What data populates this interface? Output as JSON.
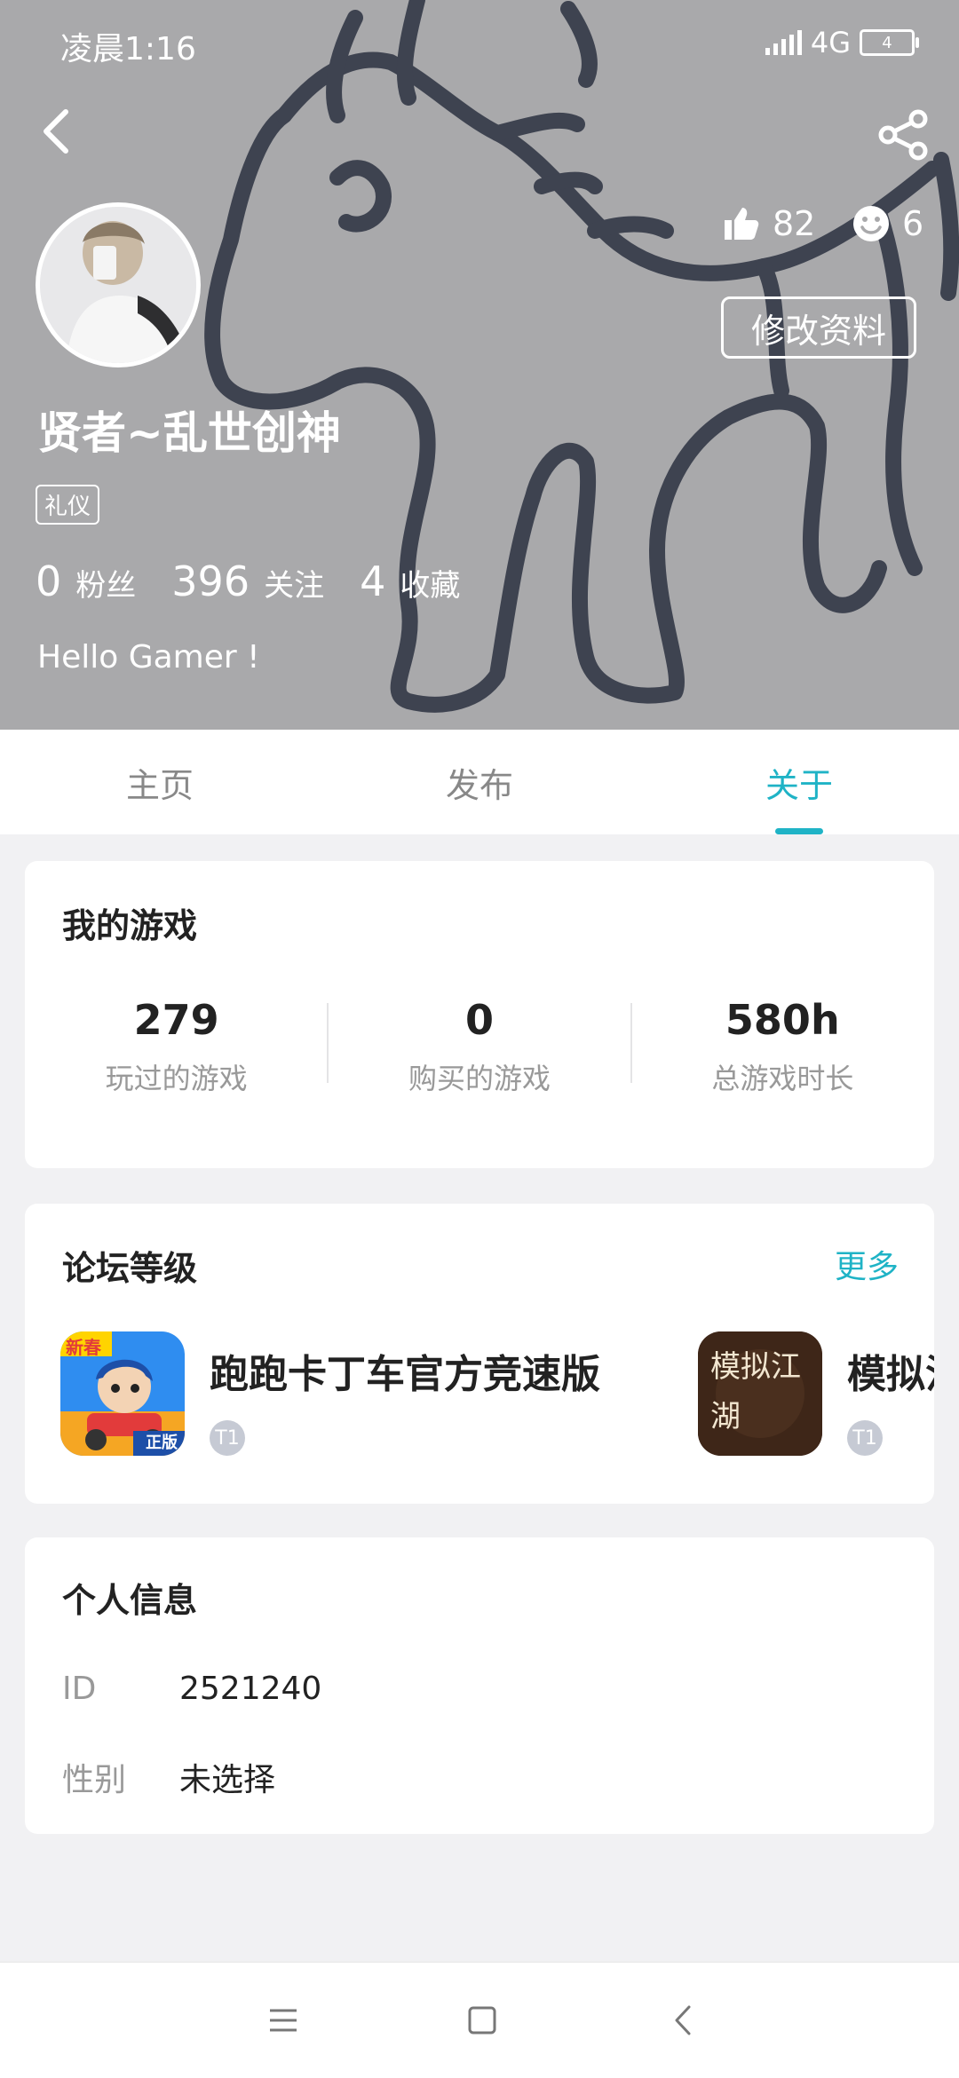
{
  "status": {
    "time": "凌晨1:16",
    "network": "4G",
    "battery": "4"
  },
  "profile": {
    "name": "贤者~乱世创神",
    "tag": "礼仪",
    "fans_count": "0",
    "fans_label": "粉丝",
    "following_count": "396",
    "following_label": "关注",
    "favorites_count": "4",
    "favorites_label": "收藏",
    "bio": "Hello Gamer !",
    "likes": "82",
    "faces": "6",
    "edit_label": "修改资料"
  },
  "tabs": [
    {
      "label": "主页",
      "active": false
    },
    {
      "label": "发布",
      "active": false
    },
    {
      "label": "关于",
      "active": true
    }
  ],
  "my_games": {
    "title": "我的游戏",
    "stats": [
      {
        "value": "279",
        "label": "玩过的游戏"
      },
      {
        "value": "0",
        "label": "购买的游戏"
      },
      {
        "value": "580h",
        "label": "总游戏时长"
      }
    ]
  },
  "forum": {
    "title": "论坛等级",
    "more": "更多",
    "games": [
      {
        "name": "跑跑卡丁车官方竞速版",
        "icon_badge": "新春",
        "icon_corner": "正版",
        "level": "T1"
      },
      {
        "name": "模拟江湖",
        "icon_text": "模拟江湖",
        "level": "T1"
      }
    ]
  },
  "personal": {
    "title": "个人信息",
    "rows": [
      {
        "key": "ID",
        "value": "2521240"
      },
      {
        "key": "性别",
        "value": "未选择"
      }
    ]
  },
  "colors": {
    "accent": "#1fb3c6",
    "header_bg": "#a9a9ab"
  },
  "icons": [
    "back-arrow-icon",
    "share-icon",
    "thumbs-up-icon",
    "smiley-icon",
    "menu-icon",
    "home-square-icon",
    "nav-back-icon"
  ]
}
